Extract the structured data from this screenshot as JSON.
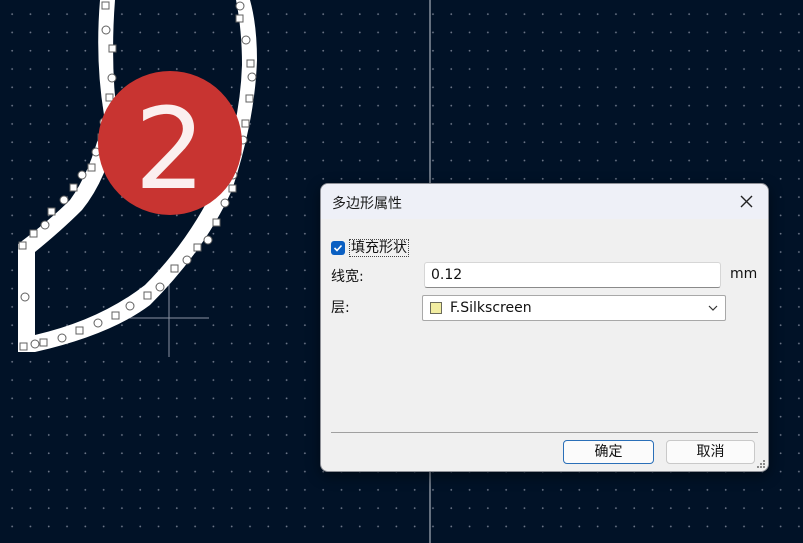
{
  "canvas": {
    "step_badge": "2",
    "badge_color": "#c83431",
    "background_color": "#011227"
  },
  "dialog": {
    "title": "多边形属性",
    "close_icon": "close-icon",
    "fill_checkbox": {
      "label": "填充形状",
      "checked": true
    },
    "line_width": {
      "label": "线宽:",
      "value": "0.12",
      "unit": "mm"
    },
    "layer": {
      "label": "层:",
      "value": "F.Silkscreen",
      "swatch_color": "#f2eda1"
    },
    "buttons": {
      "ok": "确定",
      "cancel": "取消"
    }
  }
}
